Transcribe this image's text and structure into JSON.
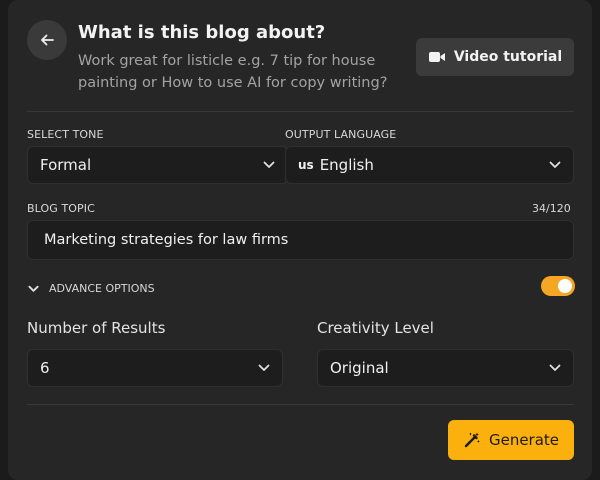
{
  "header": {
    "title": "What is this blog about?",
    "subtitle": "Work great for listicle e.g. 7 tip for house painting or How to use AI for copy writing?",
    "video_button": "Video tutorial"
  },
  "tone": {
    "label": "SELECT TONE",
    "value": "Formal"
  },
  "language": {
    "label": "OUTPUT LANGUAGE",
    "flag": "us",
    "value": "English"
  },
  "topic": {
    "label": "BLOG TOPIC",
    "counter": "34/120",
    "value": "Marketing strategies for law firms"
  },
  "advance": {
    "label": "ADVANCE OPTIONS",
    "enabled": true
  },
  "results": {
    "label": "Number of Results",
    "value": "6"
  },
  "creativity": {
    "label": "Creativity Level",
    "value": "Original"
  },
  "generate_button": "Generate",
  "colors": {
    "accent": "#fbb00e",
    "toggle": "#f5a623",
    "panel": "#262626",
    "field": "#1d1d1d"
  },
  "icons": {
    "back": "arrow-left-icon",
    "video": "video-camera-icon",
    "chevron": "chevron-down-icon",
    "generate": "magic-wand-icon"
  }
}
